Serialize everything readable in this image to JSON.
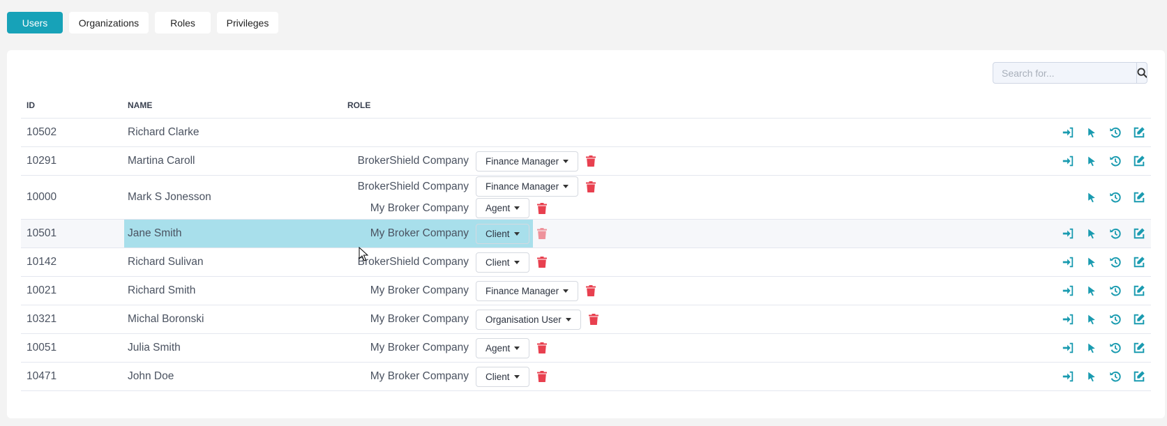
{
  "tabs": [
    {
      "label": "Users",
      "active": true
    },
    {
      "label": "Organizations",
      "active": false
    },
    {
      "label": "Roles",
      "active": false
    },
    {
      "label": "Privileges",
      "active": false
    }
  ],
  "search": {
    "placeholder": "Search for...",
    "value": "",
    "icon": "search-icon"
  },
  "table": {
    "headers": {
      "id": "ID",
      "name": "NAME",
      "role": "ROLE"
    },
    "rows": [
      {
        "id": "10502",
        "name": "Richard Clarke",
        "roles": [],
        "actions": [
          "login",
          "select",
          "history",
          "edit"
        ]
      },
      {
        "id": "10291",
        "name": "Martina Caroll",
        "roles": [
          {
            "company": "BrokerShield Company",
            "role": "Finance Manager"
          }
        ],
        "actions": [
          "login",
          "select",
          "history",
          "edit"
        ]
      },
      {
        "id": "10000",
        "name": "Mark S Jonesson",
        "roles": [
          {
            "company": "BrokerShield Company",
            "role": "Finance Manager"
          },
          {
            "company": "My Broker Company",
            "role": "Agent"
          }
        ],
        "actions": [
          "select",
          "history",
          "edit"
        ]
      },
      {
        "id": "10501",
        "name": "Jane Smith",
        "roles": [
          {
            "company": "My Broker Company",
            "role": "Client"
          }
        ],
        "actions": [
          "login",
          "select",
          "history",
          "edit"
        ],
        "hovered": true,
        "selected": true
      },
      {
        "id": "10142",
        "name": "Richard Sulivan",
        "roles": [
          {
            "company": "BrokerShield Company",
            "role": "Client"
          }
        ],
        "actions": [
          "login",
          "select",
          "history",
          "edit"
        ]
      },
      {
        "id": "10021",
        "name": "Richard Smith",
        "roles": [
          {
            "company": "My Broker Company",
            "role": "Finance Manager"
          }
        ],
        "actions": [
          "login",
          "select",
          "history",
          "edit"
        ]
      },
      {
        "id": "10321",
        "name": "Michal Boronski",
        "roles": [
          {
            "company": "My Broker Company",
            "role": "Organisation User"
          }
        ],
        "actions": [
          "login",
          "select",
          "history",
          "edit"
        ]
      },
      {
        "id": "10051",
        "name": "Julia Smith",
        "roles": [
          {
            "company": "My Broker Company",
            "role": "Agent"
          }
        ],
        "actions": [
          "login",
          "select",
          "history",
          "edit"
        ]
      },
      {
        "id": "10471",
        "name": "John Doe",
        "roles": [
          {
            "company": "My Broker Company",
            "role": "Client"
          }
        ],
        "actions": [
          "login",
          "select",
          "history",
          "edit"
        ]
      }
    ]
  },
  "colors": {
    "accent": "#17a2b8",
    "icon": "#1a9bb0",
    "danger": "#e8404f",
    "selection": "#a8dfeb"
  }
}
